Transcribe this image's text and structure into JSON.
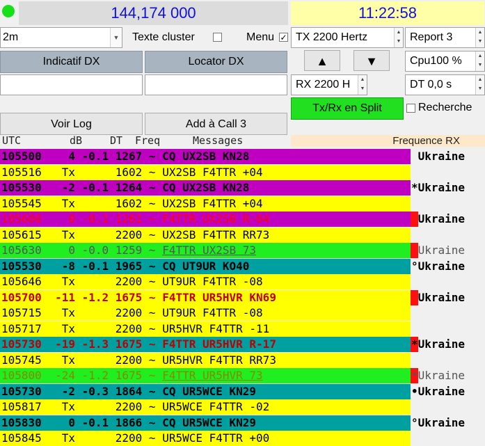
{
  "header": {
    "frequency": "144,174 000",
    "time": "11:22:58"
  },
  "controls": {
    "band": "2m",
    "texte_cluster_label": "Texte cluster",
    "menu_label": "Menu",
    "menu_checked": "✓",
    "tx_value": "TX  2200  Hertz",
    "report_value": "Report 3",
    "indicatif_label": "Indicatif DX",
    "locator_label": "Locator DX",
    "up_arrow": "▲",
    "down_arrow": "▼",
    "cpu_value": "Cpu100 %",
    "rx_value": "RX  2200  H",
    "dt_value": "DT 0,0 s",
    "split_label": "Tx/Rx en Split",
    "recherche_label": "Recherche",
    "voir_log_label": "Voir Log",
    "add_call_label": "Add à Call 3"
  },
  "columns": {
    "utc": "UTC",
    "db": "dB",
    "dt": "DT",
    "freq": "Freq",
    "messages": "Messages",
    "freq_rx": "Frequence RX"
  },
  "colors": {
    "magenta": "#c000c0",
    "yellow": "#ffff00",
    "green": "#20ee20",
    "teal": "#00a0a0",
    "red_text": "#ff0000",
    "dark_red_text": "#c00000"
  },
  "rows": [
    {
      "utc": "105500",
      "db": "4",
      "dt": "-0.1",
      "freq": "1267",
      "msg": "CQ UX2SB KN28",
      "country": " Ukraine",
      "bg": "magenta",
      "fg": "#000",
      "bold": true,
      "under": false,
      "mark": false
    },
    {
      "utc": "105516",
      "db": "Tx",
      "dt": "",
      "freq": "1602",
      "msg": "UX2SB F4TTR +04",
      "country": "",
      "bg": "yellow",
      "fg": "#000",
      "bold": false,
      "under": false,
      "mark": false
    },
    {
      "utc": "105530",
      "db": "-2",
      "dt": "-0.1",
      "freq": "1264",
      "msg": "CQ UX2SB KN28",
      "country": "*Ukraine",
      "bg": "magenta",
      "fg": "#000",
      "bold": true,
      "under": false,
      "mark": false
    },
    {
      "utc": "105545",
      "db": "Tx",
      "dt": "",
      "freq": "1602",
      "msg": "UX2SB F4TTR +04",
      "country": "",
      "bg": "yellow",
      "fg": "#000",
      "bold": false,
      "under": false,
      "mark": false
    },
    {
      "utc": "105600",
      "db": "0",
      "dt": "-0.1",
      "freq": "1261",
      "msg": "F4TTR UX2SB R-04",
      "country": " Ukraine",
      "bg": "magenta",
      "fg": "#ff0000",
      "bold": false,
      "under": false,
      "mark": true
    },
    {
      "utc": "105615",
      "db": "Tx",
      "dt": "",
      "freq": "2200",
      "msg": "UX2SB F4TTR RR73",
      "country": "",
      "bg": "yellow",
      "fg": "#000",
      "bold": false,
      "under": false,
      "mark": false
    },
    {
      "utc": "105630",
      "db": "0",
      "dt": "-0.0",
      "freq": "1259",
      "msg": "F4TTR UX2SB 73",
      "country": " Ukraine",
      "bg": "green",
      "fg": "#555",
      "bold": false,
      "under": true,
      "mark": true
    },
    {
      "utc": "105530",
      "db": "-8",
      "dt": "-0.1",
      "freq": "1965",
      "msg": "CQ UT9UR KO40",
      "country": "°Ukraine",
      "bg": "teal",
      "fg": "#000",
      "bold": true,
      "under": false,
      "mark": false
    },
    {
      "utc": "105646",
      "db": "Tx",
      "dt": "",
      "freq": "2200",
      "msg": "UT9UR F4TTR -08",
      "country": "",
      "bg": "yellow",
      "fg": "#000",
      "bold": false,
      "under": false,
      "mark": false
    },
    {
      "utc": "105700",
      "db": "-11",
      "dt": "-1.2",
      "freq": "1675",
      "msg": "F4TTR UR5HVR KN69",
      "country": " Ukraine",
      "bg": "yellow",
      "fg": "#c00000",
      "bold": true,
      "under": false,
      "mark": true
    },
    {
      "utc": "105715",
      "db": "Tx",
      "dt": "",
      "freq": "2200",
      "msg": "UT9UR F4TTR -08",
      "country": "",
      "bg": "yellow",
      "fg": "#000",
      "bold": false,
      "under": false,
      "mark": false
    },
    {
      "utc": "105717",
      "db": "Tx",
      "dt": "",
      "freq": "2200",
      "msg": "UR5HVR F4TTR -11",
      "country": "",
      "bg": "yellow",
      "fg": "#000",
      "bold": false,
      "under": false,
      "mark": false
    },
    {
      "utc": "105730",
      "db": "-19",
      "dt": "-1.3",
      "freq": "1675",
      "msg": "F4TTR UR5HVR R-17",
      "country": "*Ukraine",
      "bg": "teal",
      "fg": "#c00000",
      "bold": true,
      "under": false,
      "mark": true
    },
    {
      "utc": "105745",
      "db": "Tx",
      "dt": "",
      "freq": "2200",
      "msg": "UR5HVR F4TTR RR73",
      "country": "",
      "bg": "yellow",
      "fg": "#000",
      "bold": false,
      "under": false,
      "mark": false
    },
    {
      "utc": "105800",
      "db": "-24",
      "dt": "-1.2",
      "freq": "1675",
      "msg": "F4TTR UR5HVR 73",
      "country": "*Ukraine",
      "bg": "green",
      "fg": "#888800",
      "bold": false,
      "under": true,
      "mark": true
    },
    {
      "utc": "105730",
      "db": "-2",
      "dt": "-0.3",
      "freq": "1864",
      "msg": "CQ UR5WCE KN29",
      "country": "•Ukraine",
      "bg": "teal",
      "fg": "#000",
      "bold": true,
      "under": false,
      "mark": false
    },
    {
      "utc": "105817",
      "db": "Tx",
      "dt": "",
      "freq": "2200",
      "msg": "UR5WCE F4TTR -02",
      "country": "",
      "bg": "yellow",
      "fg": "#000",
      "bold": false,
      "under": false,
      "mark": false
    },
    {
      "utc": "105830",
      "db": "0",
      "dt": "-0.1",
      "freq": "1866",
      "msg": "CQ UR5WCE KN29",
      "country": "°Ukraine",
      "bg": "teal",
      "fg": "#000",
      "bold": true,
      "under": false,
      "mark": false
    },
    {
      "utc": "105845",
      "db": "Tx",
      "dt": "",
      "freq": "2200",
      "msg": "UR5WCE F4TTR +00",
      "country": "",
      "bg": "yellow",
      "fg": "#000",
      "bold": false,
      "under": false,
      "mark": false
    }
  ]
}
